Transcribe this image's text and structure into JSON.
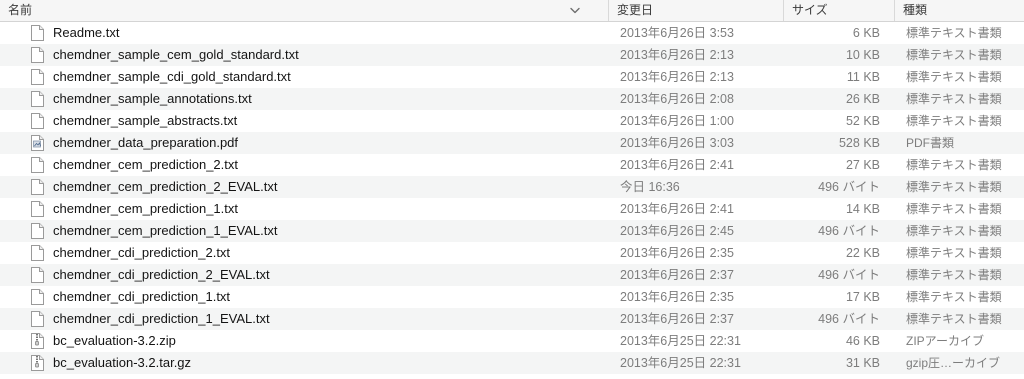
{
  "columns": {
    "name": "名前",
    "date": "変更日",
    "size": "サイズ",
    "kind": "種類"
  },
  "files": [
    {
      "name": "Readme.txt",
      "date": "2013年6月26日 3:53",
      "size": "6 KB",
      "kind": "標準テキスト書類",
      "icon": "text-document-icon"
    },
    {
      "name": "chemdner_sample_cem_gold_standard.txt",
      "date": "2013年6月26日 2:13",
      "size": "10 KB",
      "kind": "標準テキスト書類",
      "icon": "text-document-icon"
    },
    {
      "name": "chemdner_sample_cdi_gold_standard.txt",
      "date": "2013年6月26日 2:13",
      "size": "11 KB",
      "kind": "標準テキスト書類",
      "icon": "text-document-icon"
    },
    {
      "name": "chemdner_sample_annotations.txt",
      "date": "2013年6月26日 2:08",
      "size": "26 KB",
      "kind": "標準テキスト書類",
      "icon": "text-document-icon"
    },
    {
      "name": "chemdner_sample_abstracts.txt",
      "date": "2013年6月26日 1:00",
      "size": "52 KB",
      "kind": "標準テキスト書類",
      "icon": "text-document-icon"
    },
    {
      "name": "chemdner_data_preparation.pdf",
      "date": "2013年6月26日 3:03",
      "size": "528 KB",
      "kind": "PDF書類",
      "icon": "pdf-document-icon"
    },
    {
      "name": "chemdner_cem_prediction_2.txt",
      "date": "2013年6月26日 2:41",
      "size": "27 KB",
      "kind": "標準テキスト書類",
      "icon": "text-document-icon"
    },
    {
      "name": "chemdner_cem_prediction_2_EVAL.txt",
      "date": "今日 16:36",
      "size": "496 バイト",
      "kind": "標準テキスト書類",
      "icon": "text-document-icon"
    },
    {
      "name": "chemdner_cem_prediction_1.txt",
      "date": "2013年6月26日 2:41",
      "size": "14 KB",
      "kind": "標準テキスト書類",
      "icon": "text-document-icon"
    },
    {
      "name": "chemdner_cem_prediction_1_EVAL.txt",
      "date": "2013年6月26日 2:45",
      "size": "496 バイト",
      "kind": "標準テキスト書類",
      "icon": "text-document-icon"
    },
    {
      "name": "chemdner_cdi_prediction_2.txt",
      "date": "2013年6月26日 2:35",
      "size": "22 KB",
      "kind": "標準テキスト書類",
      "icon": "text-document-icon"
    },
    {
      "name": "chemdner_cdi_prediction_2_EVAL.txt",
      "date": "2013年6月26日 2:37",
      "size": "496 バイト",
      "kind": "標準テキスト書類",
      "icon": "text-document-icon"
    },
    {
      "name": "chemdner_cdi_prediction_1.txt",
      "date": "2013年6月26日 2:35",
      "size": "17 KB",
      "kind": "標準テキスト書類",
      "icon": "text-document-icon"
    },
    {
      "name": "chemdner_cdi_prediction_1_EVAL.txt",
      "date": "2013年6月26日 2:37",
      "size": "496 バイト",
      "kind": "標準テキスト書類",
      "icon": "text-document-icon"
    },
    {
      "name": "bc_evaluation-3.2.zip",
      "date": "2013年6月25日 22:31",
      "size": "46 KB",
      "kind": "ZIPアーカイブ",
      "icon": "zip-archive-icon"
    },
    {
      "name": "bc_evaluation-3.2.tar.gz",
      "date": "2013年6月25日 22:31",
      "size": "31 KB",
      "kind": "gzip圧…ーカイブ",
      "icon": "zip-archive-icon"
    }
  ],
  "colors": {
    "header_bg": "#f6f6f6",
    "row_alt": "#f4f5f5",
    "secondary_text": "#7d7d7d"
  }
}
